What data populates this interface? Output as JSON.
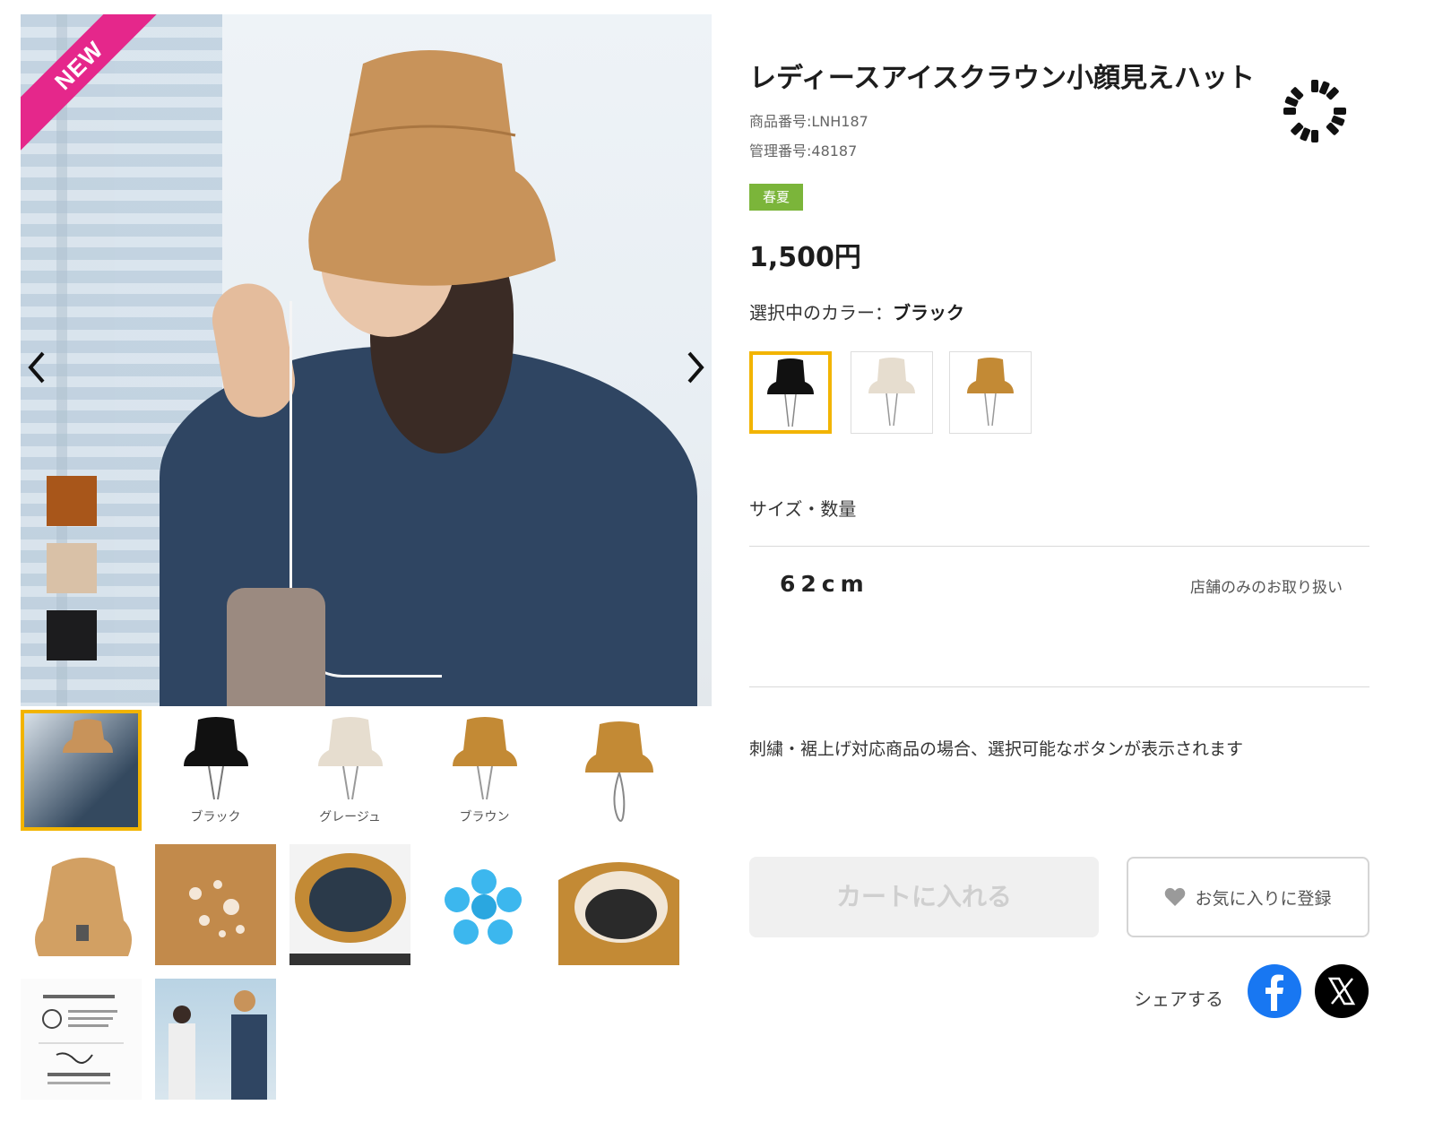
{
  "gallery": {
    "new_badge": "NEW",
    "thumbnail_labels": [
      "ブラック",
      "グレージュ",
      "ブラウン"
    ]
  },
  "product": {
    "title": "レディースアイスクラウン小顔見えハット",
    "product_number": "商品番号:LNH187",
    "management_number": "管理番号:48187",
    "season_badge": "春夏",
    "price": "1,500円",
    "color_label_prefix": "選択中のカラー：",
    "selected_color": "ブラック",
    "color_options": [
      "ブラック",
      "グレージュ",
      "ブラウン"
    ],
    "size_label": "サイズ・数量",
    "size_value": "62cm",
    "availability": "店舗のみのお取り扱い",
    "note": "刺繍・裾上げ対応商品の場合、選択可能なボタンが表示されます",
    "cart_button": "カートに入れる",
    "favorite_button": "お気に入りに登録",
    "share_label": "シェアする"
  },
  "colors": {
    "selected_outline": "#f2b400",
    "new_ribbon": "#e5278b",
    "season_badge": "#7bb53a",
    "facebook": "#1877f2",
    "x": "#000000"
  }
}
